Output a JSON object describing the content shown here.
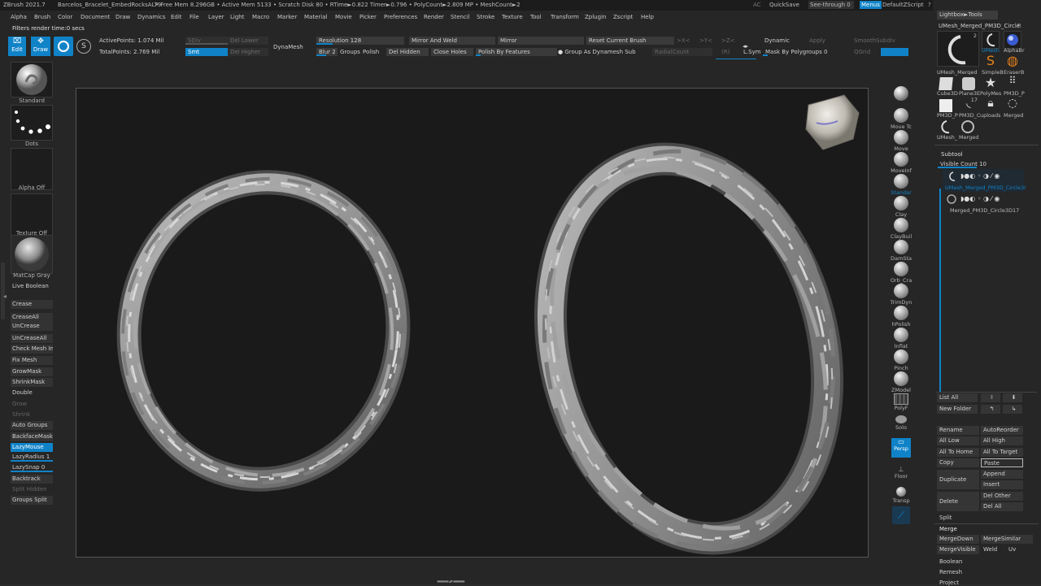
{
  "titlebar": {
    "app": "ZBrush 2021.7",
    "file": "Barcelos_Bracelet_EmbedRocksALT9",
    "stats": "• Free Mem 8.296GB • Active Mem 5133 • Scratch Disk 80 • RTime►0.822 Timer►0.796 • PolyCount►2.809 MP • MeshCount►2",
    "ac": "AC",
    "quicksave": "QuickSave",
    "seethrough": "See-through  0",
    "menus_btn": "Menus",
    "zscript": "DefaultZScript"
  },
  "menubar": [
    "Alpha",
    "Brush",
    "Color",
    "Document",
    "Draw",
    "Dynamics",
    "Edit",
    "File",
    "Layer",
    "Light",
    "Macro",
    "Marker",
    "Material",
    "Movie",
    "Picker",
    "Preferences",
    "Render",
    "Stencil",
    "Stroke",
    "Texture",
    "Tool",
    "Transform",
    "Zplugin",
    "Zscript",
    "Help"
  ],
  "status_note": "Filters render time:0 secs",
  "toolbar": {
    "edit": "Edit",
    "draw": "Draw",
    "active_points": "ActivePoints: 1.074 Mil",
    "total_points": "TotalPoints: 2.769 Mil",
    "sdiv": "SDiv",
    "smt": "Smt",
    "del_lower": "Del Lower",
    "del_higher": "Del Higher",
    "dynamesh": "DynaMesh",
    "resolution": "Resolution  128",
    "blur": "Blur  2",
    "groups": "Groups",
    "polish": "Polish",
    "del_hidden": "Del Hidden",
    "close_holes": "Close Holes",
    "mirror_weld": "Mirror And Weld",
    "mirror": "Mirror",
    "reset_brush": "Reset Current Brush",
    "polish_features": "Polish By Features",
    "group_dynamesh": "Group As Dynamesh Sub",
    "radial_count": "RadialCount",
    "xyz_x": ">X<",
    "xyz_y": ">Y<",
    "xyz_z": ">Z<",
    "r": "(R)",
    "lsym": "L.Sym",
    "dynamic": "Dynamic",
    "apply": "Apply",
    "smooth_subdiv": "SmoothSubdiv",
    "mask_polygroups": "Mask By Polygroups  0",
    "qgrid": "QGrid"
  },
  "leftshelf": {
    "brush": "Standard",
    "stroke": "Dots",
    "alpha": "Alpha Off",
    "texture": "Texture Off",
    "material": "MatCap Gray",
    "buttons": [
      {
        "label": "Live Boolean",
        "state": "normal"
      },
      {
        "label": "Crease",
        "state": "normal"
      },
      {
        "label": "CreaseAll",
        "state": "normal"
      },
      {
        "label": "UnCrease",
        "state": "normal"
      },
      {
        "label": "UnCreaseAll",
        "state": "normal"
      },
      {
        "label": "Check Mesh Integrity",
        "state": "normal"
      },
      {
        "label": "Fix Mesh",
        "state": "normal"
      },
      {
        "label": "GrowMask",
        "state": "normal"
      },
      {
        "label": "ShrinkMask",
        "state": "normal"
      },
      {
        "label": "Double",
        "state": "normal"
      },
      {
        "label": "Grow",
        "state": "dim"
      },
      {
        "label": "Shrink",
        "state": "dim"
      },
      {
        "label": "Auto Groups",
        "state": "normal"
      },
      {
        "label": "BackfaceMask",
        "state": "normal"
      },
      {
        "label": "LazyMouse",
        "state": "on"
      },
      {
        "label": "LazyRadius  1",
        "state": "normal"
      },
      {
        "label": "LazySnap  0",
        "state": "normal"
      },
      {
        "label": "Backtrack",
        "state": "normal"
      },
      {
        "label": "Split Hidden",
        "state": "dim"
      },
      {
        "label": "Groups Split",
        "state": "normal"
      }
    ]
  },
  "rightshelf": [
    "Move Tc",
    "Move",
    "MoveInf",
    "Standar",
    "Clay",
    "ClayBuil",
    "DamSta",
    "Orb_Cra",
    "TrimDyn",
    "hPolish",
    "Inflat",
    "Pinch",
    "ZModel",
    "PolyF",
    "Solo",
    "Persp",
    "Floor",
    "Transp"
  ],
  "tray": {
    "lightbox": "Lightbox►Tools",
    "current_tool": "UMesh_Merged_PM3D_Circle",
    "current_tool_r": "R",
    "tools": [
      {
        "label": "UMesh_Merged",
        "count": "2"
      },
      {
        "label": "SimpleB",
        "count": ""
      },
      {
        "label": "EraserB",
        "count": ""
      },
      {
        "label": "Cube3D",
        "count": ""
      },
      {
        "label": "Plane3E",
        "count": ""
      },
      {
        "label": "PolyMes",
        "count": ""
      },
      {
        "label": "PM3D_P",
        "count": ""
      },
      {
        "label": "PM3D_P",
        "count": ""
      },
      {
        "label": "PM3D_C",
        "count": "17"
      },
      {
        "label": "uploads",
        "count": ""
      },
      {
        "label": "Merged",
        "count": ""
      },
      {
        "label": "UMesh_",
        "count": ""
      },
      {
        "label": "Merged",
        "count": ""
      }
    ],
    "alpha_brush": "AlphaBr",
    "subtool_title": "Subtool",
    "visible_count": "Visible Count  10",
    "subtools": [
      {
        "name": "UMesh_Merged_PM3D_Circle3I",
        "active": true
      },
      {
        "name": "Merged_PM3D_Circle3D17",
        "active": false
      }
    ],
    "list_all": "List All",
    "new_folder": "New Folder",
    "rename": "Rename",
    "autoreorder": "AutoReorder",
    "all_low": "All Low",
    "all_high": "All High",
    "all_to_home": "All To Home",
    "all_to_target": "All To Target",
    "copy": "Copy",
    "paste": "Paste",
    "duplicate": "Duplicate",
    "append": "Append",
    "insert": "Insert",
    "delete": "Delete",
    "del_other": "Del Other",
    "del_all": "Del All",
    "split": "Split",
    "merge": "Merge",
    "merge_down": "MergeDown",
    "merge_similar": "MergeSimilar",
    "merge_visible": "MergeVisible",
    "weld": "Weld",
    "uv": "Uv",
    "boolean": "Boolean",
    "remesh": "Remesh",
    "project": "Project"
  },
  "colors": {
    "accent": "#1083c8",
    "bg": "#262626",
    "viewport": "#1a1a1a"
  }
}
